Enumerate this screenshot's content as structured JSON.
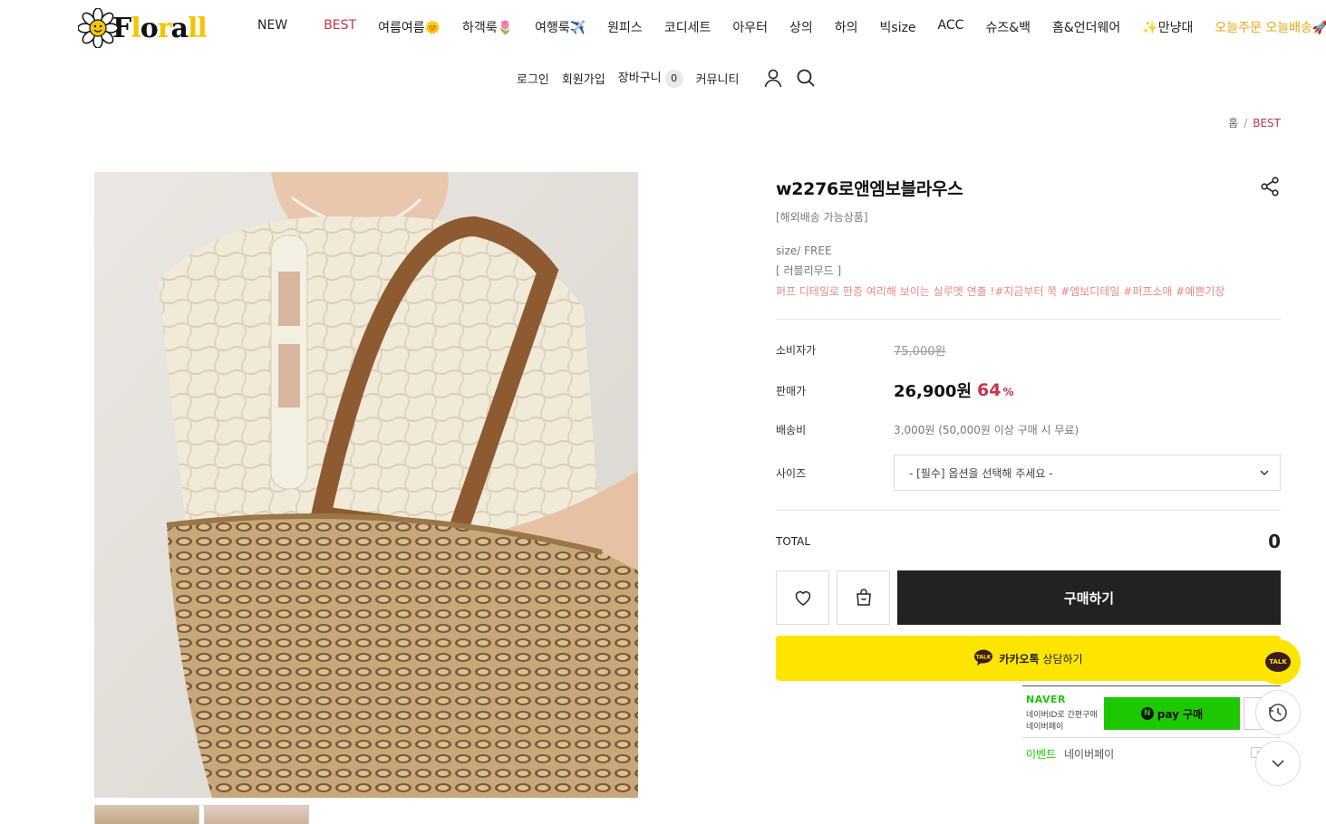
{
  "brand": {
    "logo_text": "Florall"
  },
  "nav": {
    "items": [
      {
        "label": "NEW"
      },
      {
        "label": "BEST",
        "highlight": "best"
      },
      {
        "label": "여름여름🌞"
      },
      {
        "label": "하객룩🌷"
      },
      {
        "label": "여행룩✈️"
      },
      {
        "label": "원피스"
      },
      {
        "label": "코디세트"
      },
      {
        "label": "아우터"
      },
      {
        "label": "상의"
      },
      {
        "label": "하의"
      },
      {
        "label": "빅size"
      },
      {
        "label": "ACC"
      },
      {
        "label": "슈즈&백"
      },
      {
        "label": "홈&언더웨어"
      },
      {
        "label": "✨만냥대"
      },
      {
        "label": "오늘주문 오늘배송🚀",
        "highlight": "today"
      }
    ]
  },
  "subnav": {
    "login": "로그인",
    "join": "회원가입",
    "cart": "장바구니",
    "cart_count": "0",
    "community": "커뮤니티",
    "user_icon": "user-icon",
    "search_icon": "search-icon"
  },
  "breadcrumb": {
    "home": "홈",
    "sep": "/",
    "current": "BEST"
  },
  "product": {
    "name": "w2276로앤엠보블라우스",
    "overseas": "[해외배송 가능상품]",
    "size_text": "size/ FREE",
    "fit_text": "[ 러블리무드 ]",
    "tag_text": "퍼프 디테일로 한층 여리해 보이는 실루엣 연출 !#지금부터 쭉 #엠보디테일 #퍼프소매 #예쁜기장",
    "consumer_label": "소비자가",
    "consumer_price": "75,000원",
    "sale_label": "판매가",
    "sale_price": "26,900원",
    "discount": "64",
    "discount_unit": "%",
    "ship_label": "배송비",
    "ship_text": "3,000원 (50,000원 이상 구매 시 무료)",
    "size_label": "사이즈",
    "size_placeholder": "- [필수] 옵션을 선택해 주세요 -",
    "total_label": "TOTAL",
    "total_value": "0",
    "buy_label": "구매하기",
    "kakao_brand": "카카오톡",
    "kakao_text": "상담하기"
  },
  "naver": {
    "brand": "NAVER",
    "line1": "네이버ID로 간편구매",
    "line2": "네이버페이",
    "pay_label": "pay 구매",
    "event": "이벤트",
    "event_sub": "네이버페이"
  },
  "floating": {
    "talk": "TALK"
  },
  "colors": {
    "accent": "#c6354a",
    "kakao": "#fee500",
    "naver": "#1ec800",
    "buy": "#222222"
  }
}
